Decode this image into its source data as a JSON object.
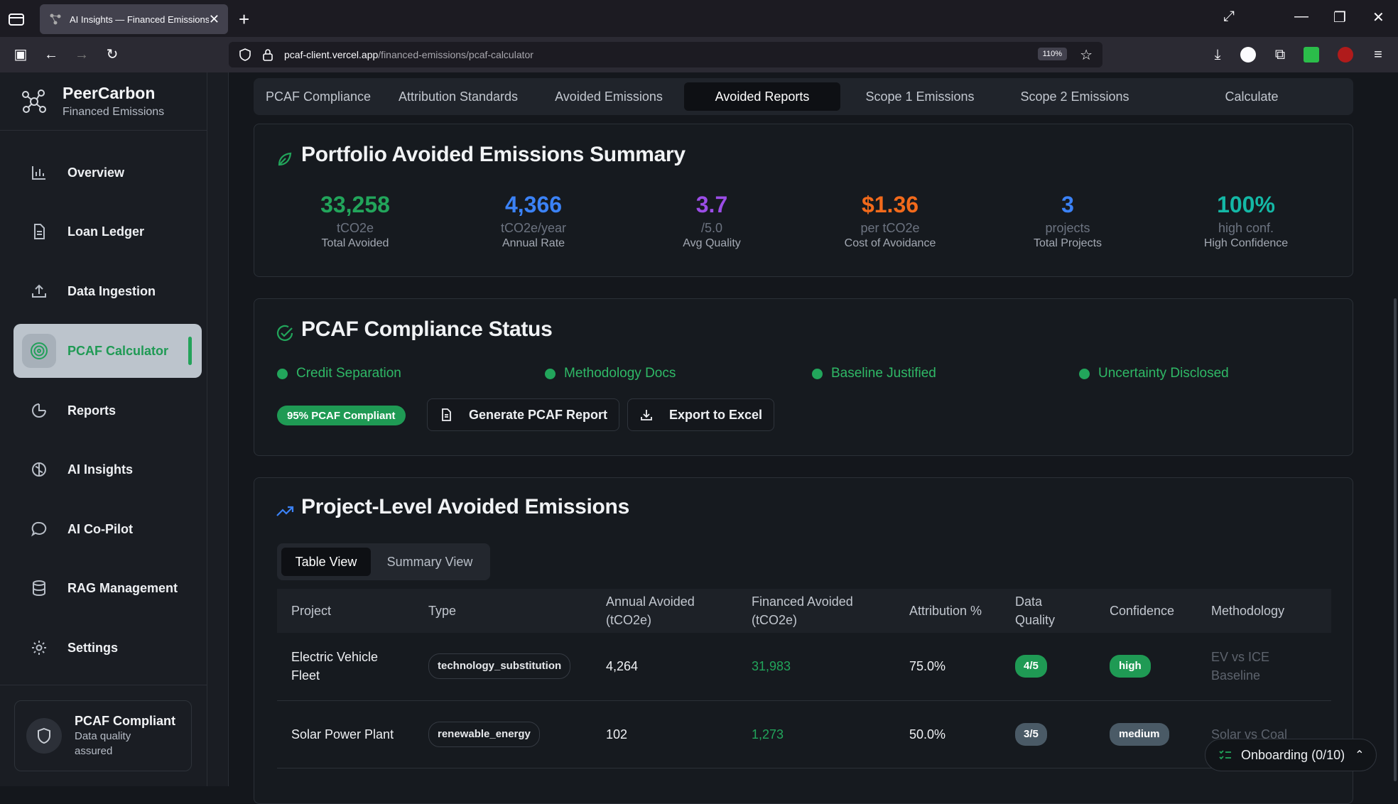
{
  "browser": {
    "tab_title": "AI Insights — Financed Emissions",
    "url_host": "pcaf-client.vercel.app",
    "url_path": "/financed-emissions/pcaf-calculator",
    "zoom": "110%"
  },
  "sidebar": {
    "brand_name": "PeerCarbon",
    "brand_sub": "Financed Emissions",
    "items": [
      {
        "label": "Overview",
        "icon": "bar-chart-icon"
      },
      {
        "label": "Loan Ledger",
        "icon": "document-icon"
      },
      {
        "label": "Data Ingestion",
        "icon": "upload-icon"
      },
      {
        "label": "PCAF Calculator",
        "icon": "target-icon",
        "active": true
      },
      {
        "label": "Reports",
        "icon": "pie-chart-icon"
      },
      {
        "label": "AI Insights",
        "icon": "brain-icon"
      },
      {
        "label": "AI Co-Pilot",
        "icon": "chat-icon"
      },
      {
        "label": "RAG Management",
        "icon": "database-icon"
      },
      {
        "label": "Settings",
        "icon": "gear-icon"
      }
    ],
    "footer": {
      "title": "PCAF Compliant",
      "line1": "Data quality",
      "line2": "assured"
    }
  },
  "tabs": [
    "PCAF Compliance",
    "Attribution Standards",
    "Avoided Emissions",
    "Avoided Reports",
    "Scope 1 Emissions",
    "Scope 2 Emissions",
    "Calculate"
  ],
  "active_tab": "Avoided Reports",
  "summary": {
    "title": "Portfolio Avoided Emissions Summary",
    "stats": [
      {
        "value": "33,258",
        "unit": "tCO2e",
        "label": "Total Avoided",
        "color": "#22a55b"
      },
      {
        "value": "4,366",
        "unit": "tCO2e/year",
        "label": "Annual Rate",
        "color": "#3b82f6"
      },
      {
        "value": "3.7",
        "unit": "/5.0",
        "label": "Avg Quality",
        "color": "#9b4de6"
      },
      {
        "value": "$1.36",
        "unit": "per tCO2e",
        "label": "Cost of Avoidance",
        "color": "#f26a1b"
      },
      {
        "value": "3",
        "unit": "projects",
        "label": "Total Projects",
        "color": "#3b82f6"
      },
      {
        "value": "100%",
        "unit": "high conf.",
        "label": "High Confidence",
        "color": "#14b8a6"
      }
    ]
  },
  "compliance": {
    "title": "PCAF Compliance Status",
    "checks": [
      "Credit Separation",
      "Methodology Docs",
      "Baseline Justified",
      "Uncertainty Disclosed"
    ],
    "badge": "95% PCAF Compliant",
    "generate_label": "Generate PCAF Report",
    "export_label": "Export to Excel"
  },
  "projects": {
    "title": "Project-Level Avoided Emissions",
    "view_table": "Table View",
    "view_summary": "Summary View",
    "headers": [
      "Project",
      "Type",
      "Annual Avoided (tCO2e)",
      "Financed Avoided (tCO2e)",
      "Attribution %",
      "Data Quality",
      "Confidence",
      "Methodology"
    ],
    "rows": [
      {
        "project": "Electric Vehicle Fleet",
        "type": "technology_substitution",
        "annual": "4,264",
        "financed": "31,983",
        "attribution": "75.0%",
        "quality": "4/5",
        "confidence": "high",
        "methodology": "EV vs ICE Baseline"
      },
      {
        "project": "Solar Power Plant",
        "type": "renewable_energy",
        "annual": "102",
        "financed": "1,273",
        "attribution": "50.0%",
        "quality": "3/5",
        "confidence": "medium",
        "methodology": "Solar vs Coal"
      }
    ]
  },
  "onboarding": "Onboarding (0/10)"
}
